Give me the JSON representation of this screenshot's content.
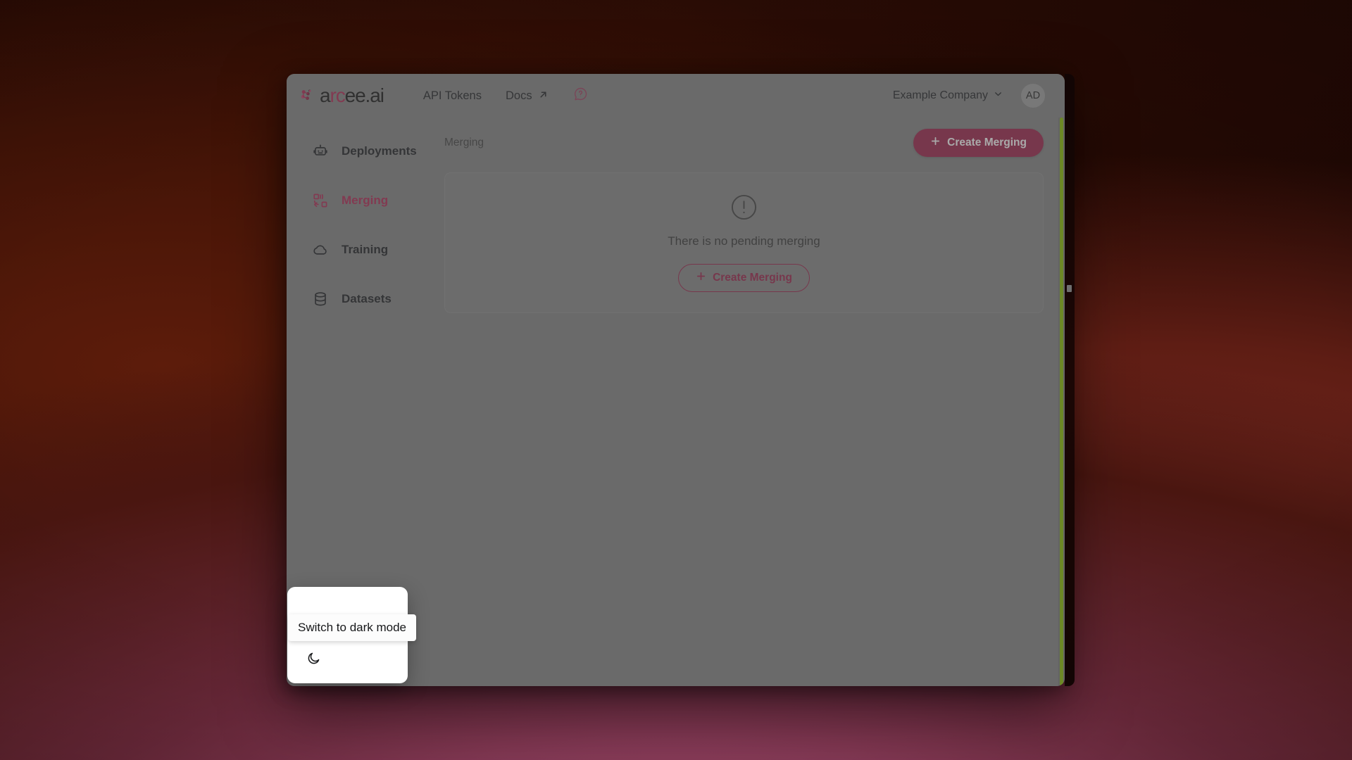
{
  "header": {
    "logo_text_pre": "a",
    "logo_text_accent": "rc",
    "logo_text_post": "ee.ai",
    "logo_icon": "arcee-cluster-icon",
    "nav": [
      {
        "label": "API Tokens",
        "icon": null,
        "external": false
      },
      {
        "label": "Docs",
        "icon": "external-link-icon",
        "external": true
      }
    ],
    "help_icon": "message-circle-question-icon",
    "company": "Example Company",
    "company_caret": "chevron-down-icon",
    "avatar_initials": "AD"
  },
  "sidebar": {
    "items": [
      {
        "label": "Deployments",
        "icon": "bot-icon",
        "active": false
      },
      {
        "label": "Merging",
        "icon": "merge-icon",
        "active": true
      },
      {
        "label": "Training",
        "icon": "cloud-icon",
        "active": false
      },
      {
        "label": "Datasets",
        "icon": "database-icon",
        "active": false
      }
    ],
    "footer": {
      "theme_toggle_icon": "moon-icon",
      "collapse_icon": "arrow-left-to-line-icon"
    }
  },
  "main": {
    "breadcrumb": "Merging",
    "primary_button": {
      "label": "Create Merging",
      "icon": "plus-icon"
    },
    "empty_state": {
      "icon": "alert-circle-icon",
      "message": "There is no pending merging",
      "button": {
        "label": "Create Merging",
        "icon": "plus-icon"
      }
    }
  },
  "overlay": {
    "tooltip": "Switch to dark mode",
    "moon_icon": "moon-icon"
  },
  "colors": {
    "accent": "#9b1b45",
    "accent_text": "#b0214f",
    "app_surface": "#808080",
    "scrollbar": "#6d8c1f",
    "tooltip_bg": "#fcfcfc"
  }
}
